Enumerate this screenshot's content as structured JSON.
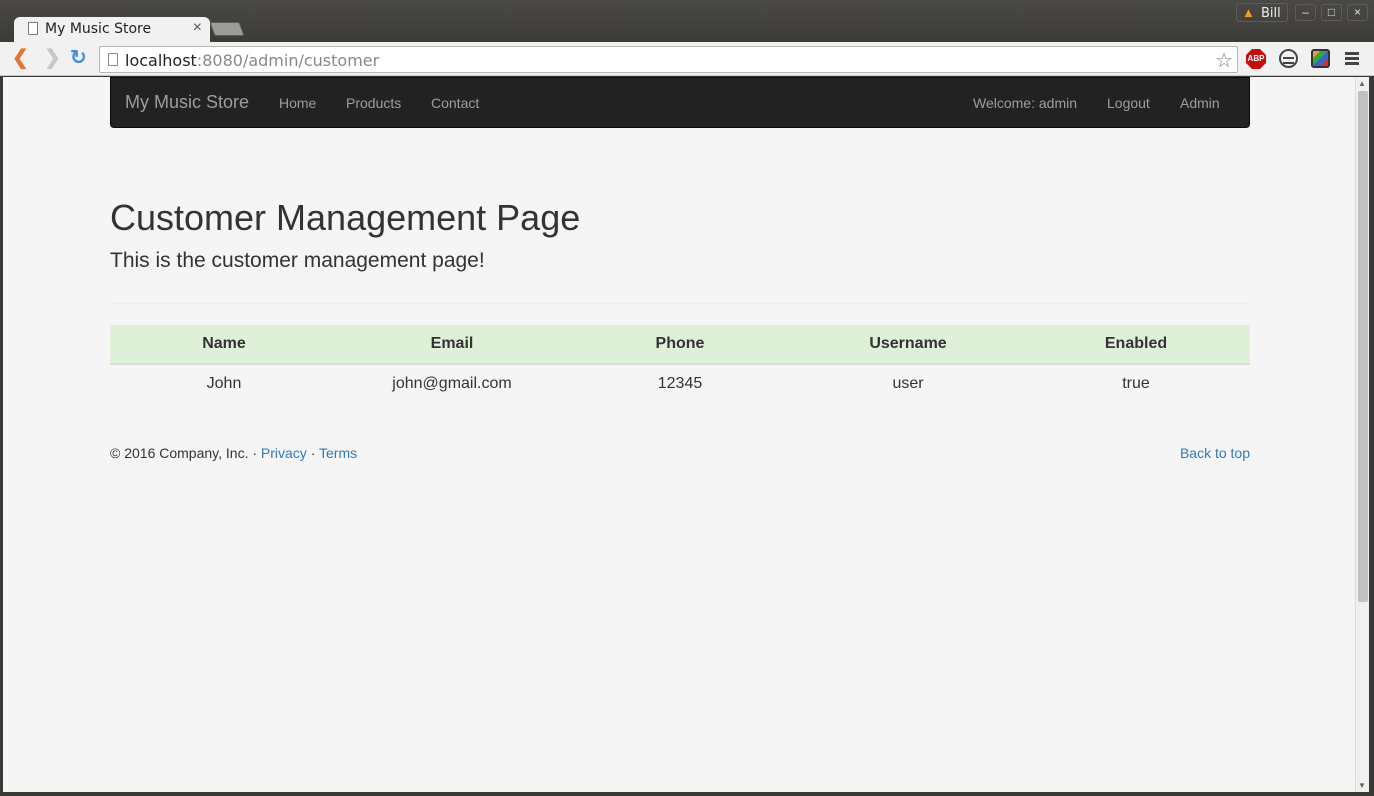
{
  "browser": {
    "tab_title": "My Music Store",
    "tab_close": "×",
    "user_name": "Bill",
    "url_host": "localhost",
    "url_rest": ":8080/admin/customer",
    "abp_label": "ABP",
    "window_controls": [
      "–",
      "□",
      "×"
    ]
  },
  "navbar": {
    "brand": "My Music Store",
    "links": [
      "Home",
      "Products",
      "Contact"
    ],
    "welcome": "Welcome: admin",
    "logout": "Logout",
    "admin": "Admin"
  },
  "page": {
    "title": "Customer Management Page",
    "lead": "This is the customer management page!"
  },
  "table": {
    "headers": [
      "Name",
      "Email",
      "Phone",
      "Username",
      "Enabled"
    ],
    "rows": [
      [
        "John",
        "john@gmail.com",
        "12345",
        "user",
        "true"
      ]
    ],
    "header_bg": "#dff0d8"
  },
  "footer": {
    "copyright": "© 2016 Company, Inc. · ",
    "privacy": "Privacy",
    "separator": " · ",
    "terms": "Terms",
    "back_to_top": "Back to top"
  },
  "colors": {
    "navbar_bg": "#222222",
    "link": "#337ab7",
    "page_bg": "#f5f5f5"
  }
}
